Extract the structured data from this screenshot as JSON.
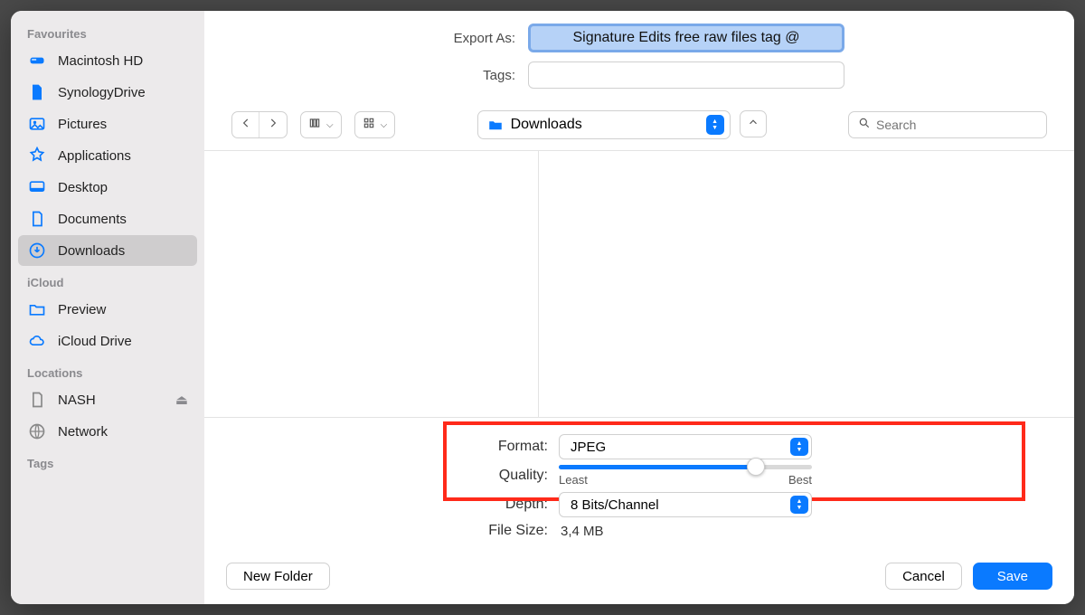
{
  "header": {
    "export_as_label": "Export As:",
    "filename": "Signature Edits free raw files tag @",
    "tags_label": "Tags:",
    "tags_value": ""
  },
  "toolbar": {
    "current_folder": "Downloads",
    "search_placeholder": "Search"
  },
  "sidebar": {
    "favourites_title": "Favourites",
    "favourites": [
      {
        "label": "Macintosh HD",
        "icon": "disk"
      },
      {
        "label": "SynologyDrive",
        "icon": "doc"
      },
      {
        "label": "Pictures",
        "icon": "photo"
      },
      {
        "label": "Applications",
        "icon": "app"
      },
      {
        "label": "Desktop",
        "icon": "desktop"
      },
      {
        "label": "Documents",
        "icon": "docs"
      },
      {
        "label": "Downloads",
        "icon": "download",
        "selected": true
      }
    ],
    "icloud_title": "iCloud",
    "icloud": [
      {
        "label": "Preview",
        "icon": "folder"
      },
      {
        "label": "iCloud Drive",
        "icon": "cloud"
      }
    ],
    "locations_title": "Locations",
    "locations": [
      {
        "label": "NASH",
        "icon": "drive",
        "ejectable": true
      },
      {
        "label": "Network",
        "icon": "globe"
      }
    ],
    "tags_title": "Tags"
  },
  "options": {
    "format_label": "Format:",
    "format_value": "JPEG",
    "quality_label": "Quality:",
    "quality_percent": 78,
    "quality_least": "Least",
    "quality_best": "Best",
    "depth_label": "Depth:",
    "depth_value": "8 Bits/Channel",
    "filesize_label": "File Size:",
    "filesize_value": "3,4 MB"
  },
  "footer": {
    "new_folder": "New Folder",
    "cancel": "Cancel",
    "save": "Save"
  }
}
